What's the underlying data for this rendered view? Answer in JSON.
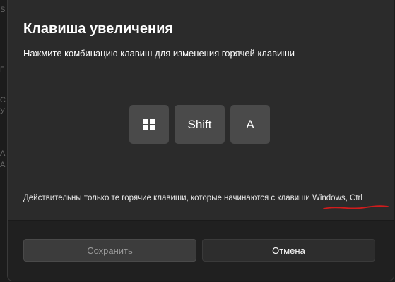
{
  "background": {
    "glyphs": [
      "S",
      "Г",
      "С",
      "У",
      "А",
      "А"
    ]
  },
  "dialog": {
    "title": "Клавиша увеличения",
    "subtitle": "Нажмите комбинацию клавиш для изменения горячей клавиши",
    "keys": [
      {
        "name": "windows",
        "icon": "windows-logo-icon"
      },
      {
        "name": "shift",
        "label": "Shift"
      },
      {
        "name": "a",
        "label": "A"
      }
    ],
    "note": "Действительны только те горячие клавиши, которые начинаются с клавиши Windows, Ctrl",
    "annotation_color": "#d11c1c",
    "buttons": {
      "save_label": "Сохранить",
      "cancel_label": "Отмена"
    }
  }
}
